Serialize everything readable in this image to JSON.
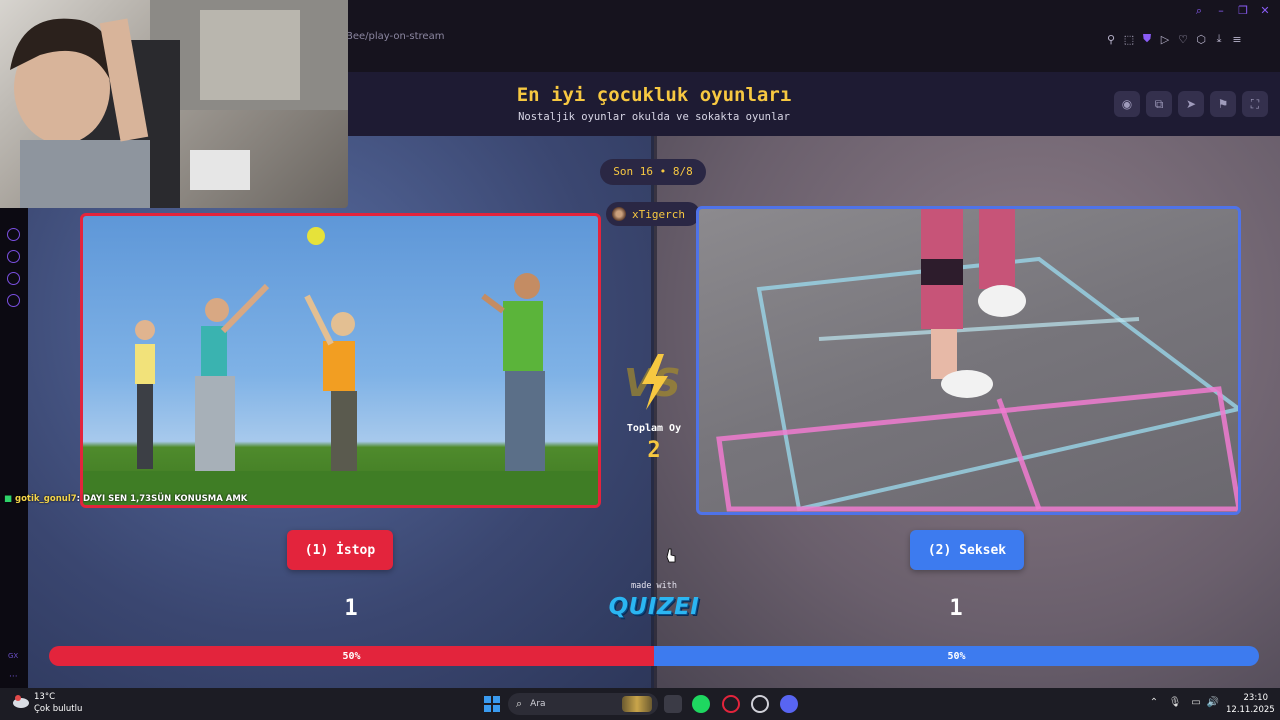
{
  "browser": {
    "url_fragment": "Bee/play-on-stream"
  },
  "quiz": {
    "title": "En iyi çocukluk oyunları",
    "subtitle": "Nostaljik oyunlar okulda ve sokakta oyunlar",
    "round_label": "Son 16 • 8/8",
    "player_name": "xTigerch",
    "total_votes_label": "Toplam Oy",
    "total_votes": "2",
    "options": [
      {
        "label": "(1) İstop",
        "votes": "1",
        "percent_label": "50%",
        "percent": 50,
        "color": "#e3243c"
      },
      {
        "label": "(2) Seksek",
        "votes": "1",
        "percent_label": "50%",
        "percent": 50,
        "color": "#3d7bef"
      }
    ],
    "made_with": "made with",
    "brand": "QUIZEI"
  },
  "stream_chat": {
    "username": "gotik_gonul7",
    "message": ": DAYI SEN 1,73SÜN KONUSMA AMK"
  },
  "taskbar": {
    "weather_temp": "13°C",
    "weather_desc": "Çok bulutlu",
    "search_placeholder": "Ara",
    "time": "23:10",
    "date": "12.11.2025"
  },
  "icons": {
    "header_buttons": [
      "eye-icon",
      "share-icon",
      "send-icon",
      "flag-icon",
      "fullscreen-icon"
    ]
  }
}
